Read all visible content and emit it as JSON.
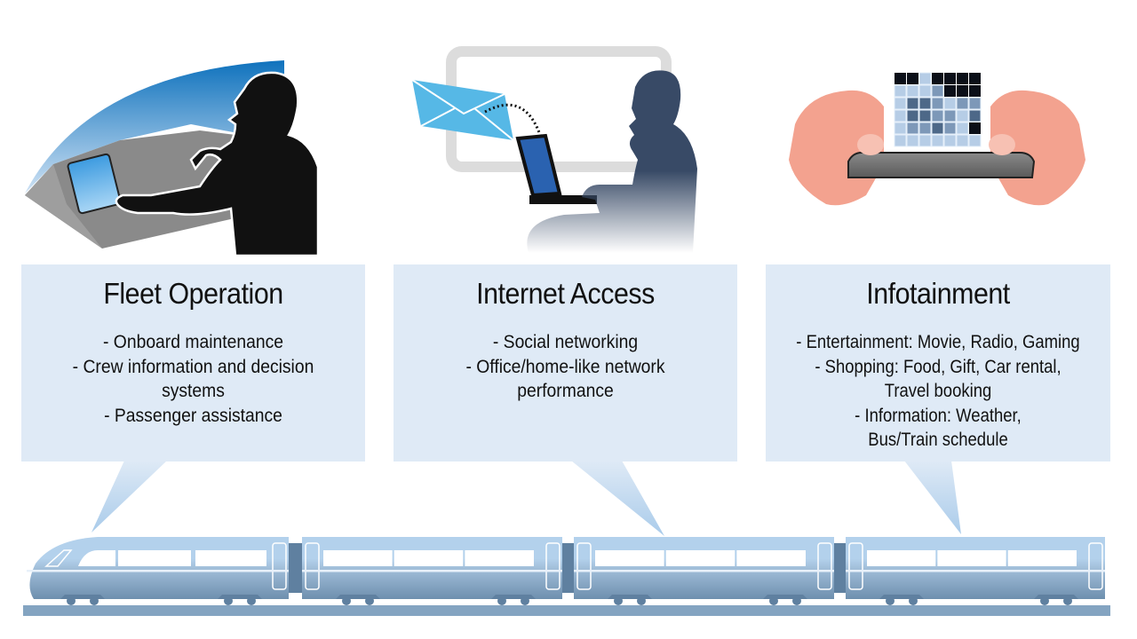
{
  "panels": [
    {
      "title": "Fleet Operation",
      "illustration": "person-touching-cockpit-screen",
      "items": [
        "- Onboard maintenance",
        "- Crew information and decision",
        "systems",
        "- Passenger assistance"
      ]
    },
    {
      "title": "Internet Access",
      "illustration": "person-laptop-email",
      "items": [
        "- Social networking",
        "- Office/home-like network",
        "performance"
      ]
    },
    {
      "title": "Infotainment",
      "illustration": "hands-holding-phone-game",
      "items": [
        "- Entertainment: Movie, Radio, Gaming",
        "- Shopping: Food, Gift, Car rental,",
        "Travel booking",
        "- Information: Weather,",
        "Bus/Train schedule"
      ]
    }
  ],
  "train": {
    "cars": 4,
    "illustration": "high-speed-train"
  },
  "colors": {
    "box_fill": "#dfeaf6",
    "train_light": "#b3d1ec",
    "train_dark": "#6e8fae",
    "sky_blue": "#1a7cc4",
    "skin": "#f3a28f",
    "silhouette_dark": "#111111",
    "silhouette_navy": "#384a66",
    "envelope": "#56b8e6"
  }
}
